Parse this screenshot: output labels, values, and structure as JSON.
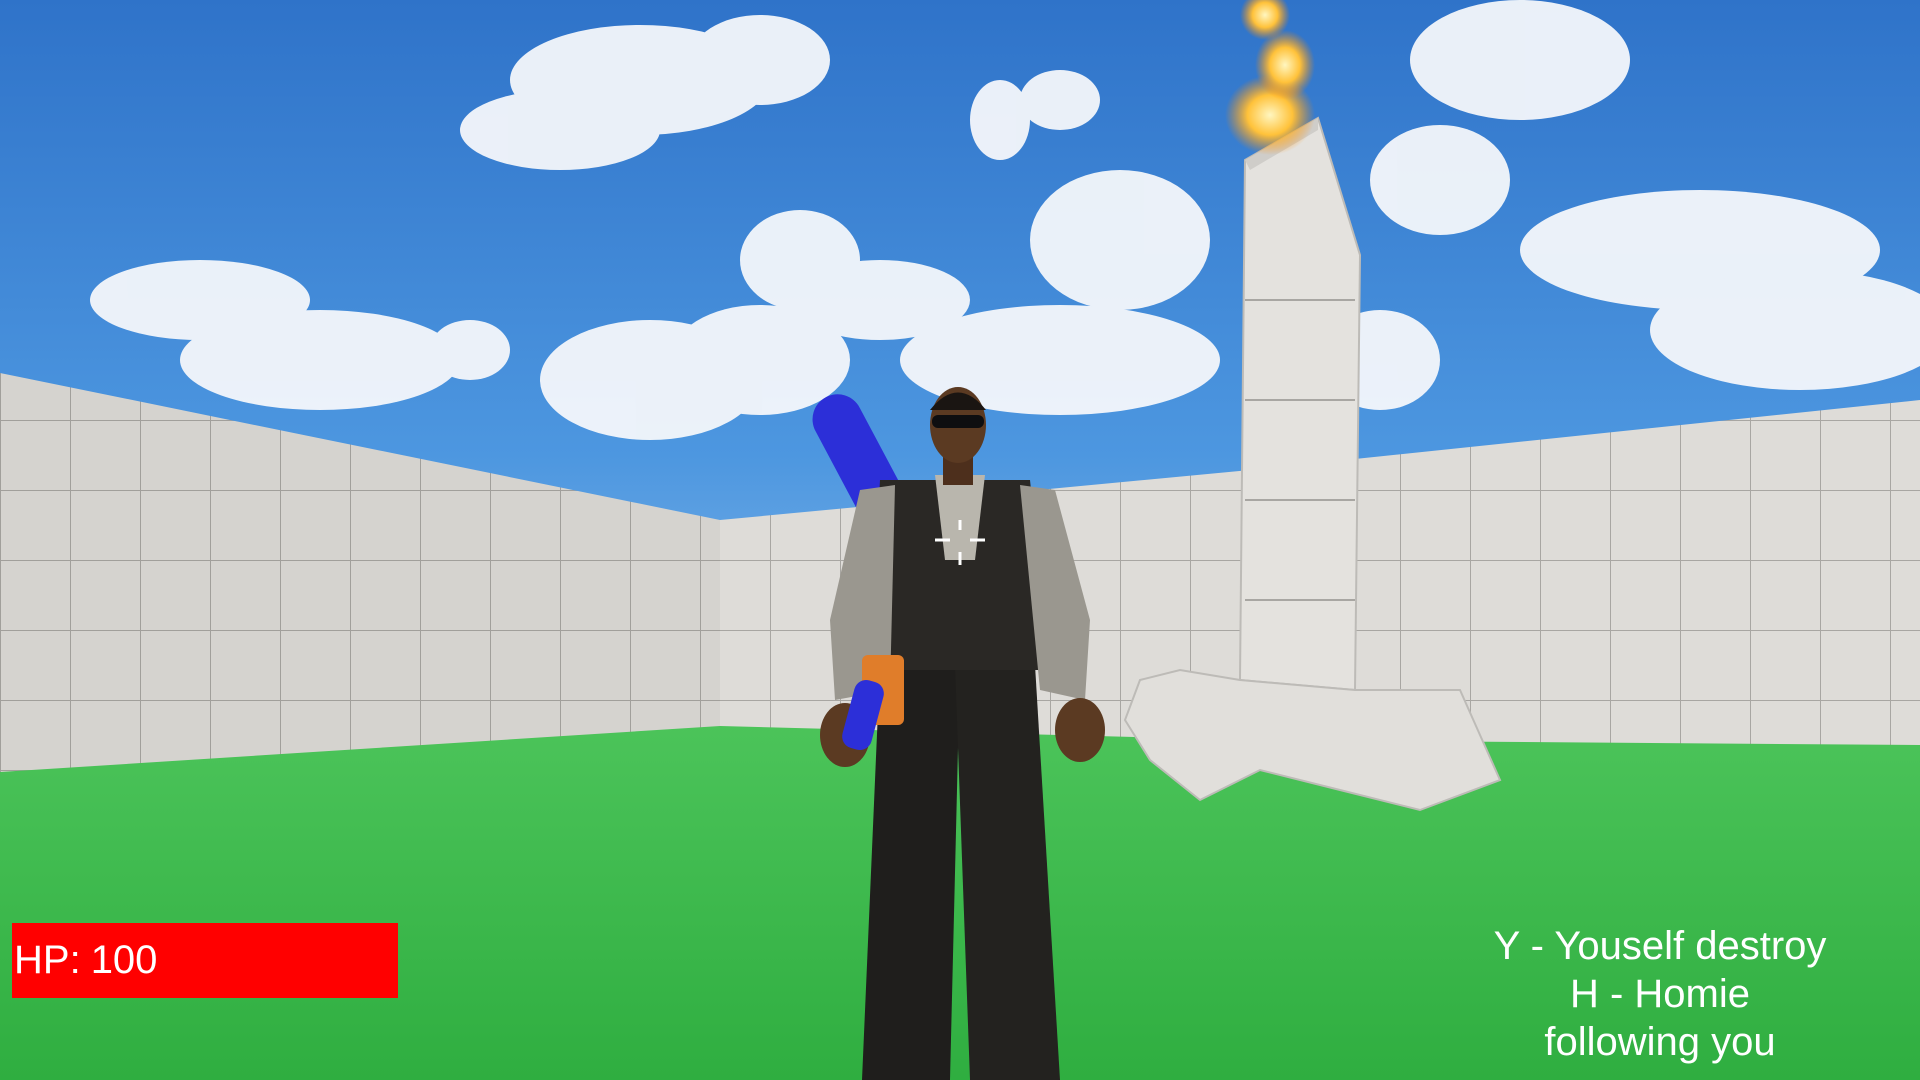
{
  "hud": {
    "hp_label": "HP:",
    "hp_value": "100",
    "hp_color": "#ff0000",
    "controls": [
      "Y - Youself destroy",
      "H - Homie",
      "following you"
    ],
    "text_color": "#ffffff"
  },
  "scene": {
    "sky_color": "#3a86d8",
    "ground_color": "#3fb84f",
    "wall_color": "#dcdad6",
    "icons": [
      "crosshair-icon",
      "fire-effect-icon"
    ]
  }
}
